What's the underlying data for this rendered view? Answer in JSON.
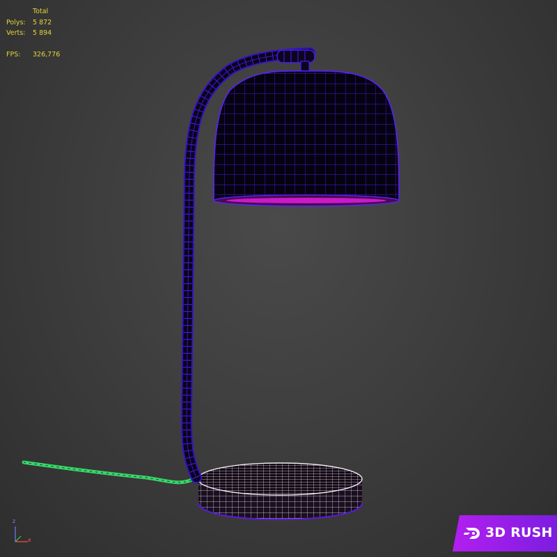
{
  "stats": {
    "total_heading": "Total",
    "polys_label": "Polys:",
    "polys_value": "5 872",
    "verts_label": "Verts:",
    "verts_value": "5 894",
    "fps_label": "FPS:",
    "fps_value": "326,776"
  },
  "axis_gizmo": {
    "z_label": "z",
    "x_label": "x"
  },
  "watermark": {
    "text": "3D RUSH",
    "icon": "rush-logo-icon"
  },
  "colors": {
    "stats_text": "#e6d43a",
    "lamp_wire": "#3b10d8",
    "shade_rim": "#d020d0",
    "base_wire": "#f0e0f0",
    "cord_wire": "#40e070",
    "watermark_bg": "#9a1eea"
  },
  "scene": {
    "object": "wireframe desk lamp"
  }
}
